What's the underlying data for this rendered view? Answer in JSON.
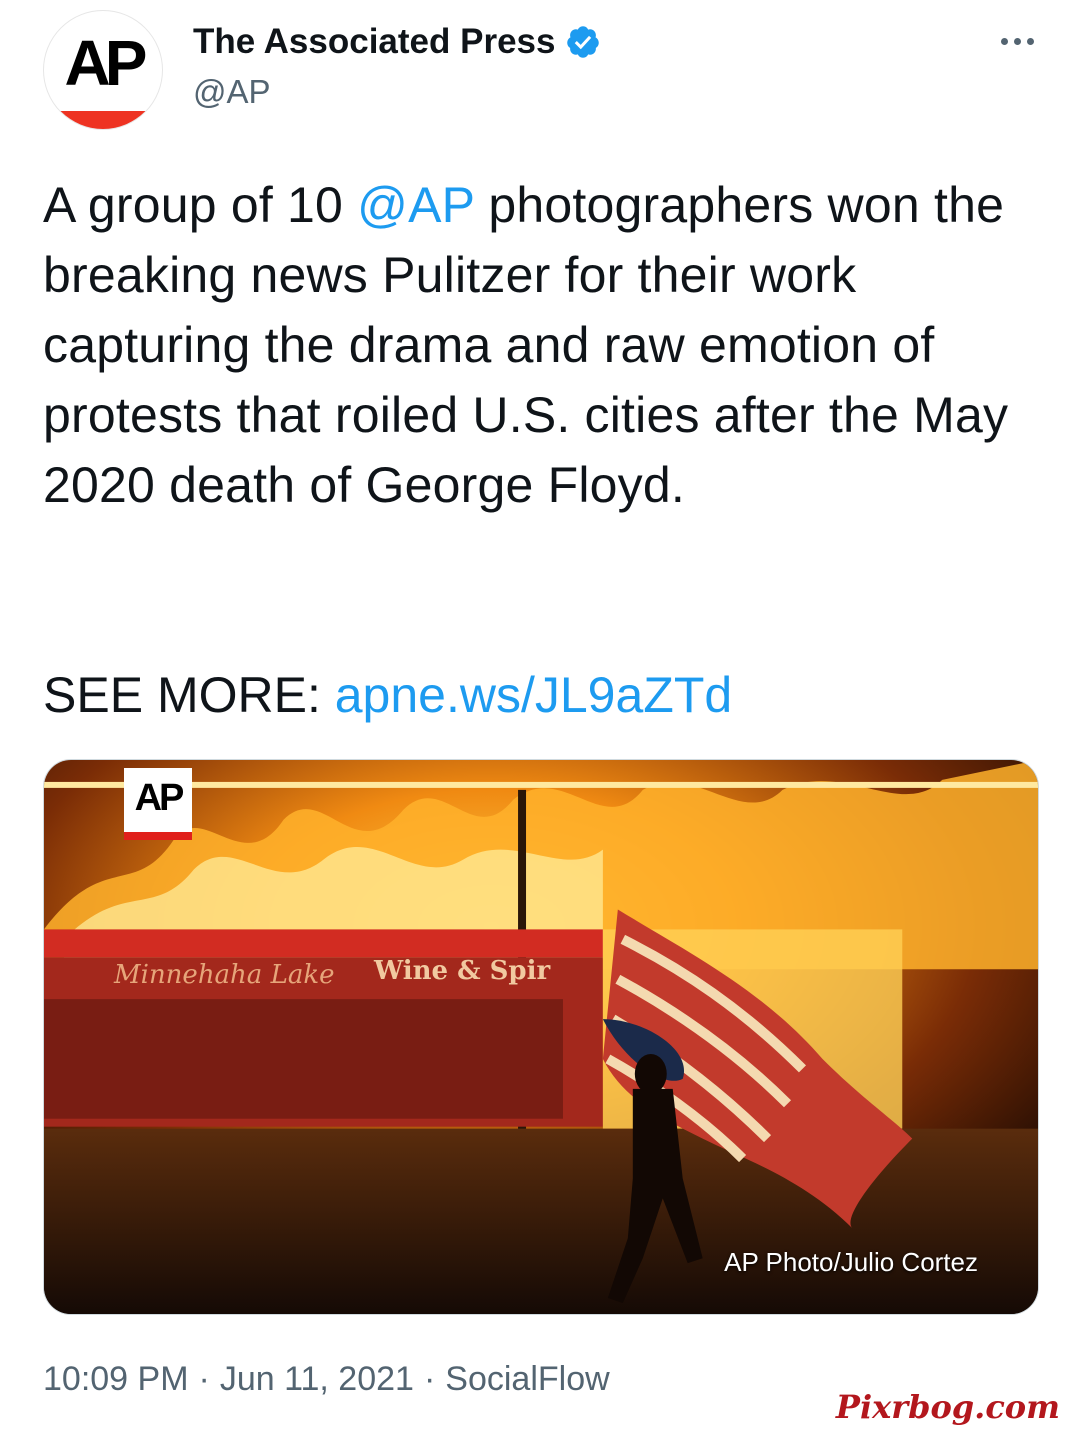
{
  "author": {
    "display_name": "The Associated Press",
    "handle": "@AP",
    "avatar_text": "AP",
    "verified": true
  },
  "tweet": {
    "text_before": "A group of 10 ",
    "mention": "@AP",
    "text_after": " photographers won the breaking news Pulitzer for their work capturing the drama and raw emotion of protests that roiled U.S. cities after the May 2020 death of George Floyd.",
    "see_more_label": "SEE MORE: ",
    "link": "apne.ws/JL9aZTd"
  },
  "media": {
    "logo_text": "AP",
    "credit": "AP Photo/Julio Cortez",
    "sign_script": "Minnehaha Lake",
    "sign_block": "Wine & Spir"
  },
  "meta": {
    "time": "10:09 PM",
    "date": "Jun 11, 2021",
    "source": "SocialFlow",
    "separator": "·"
  },
  "watermark": "Pixrbog.com",
  "colors": {
    "accent": "#1d9bf0",
    "text": "#0f1419",
    "secondary": "#536471",
    "ap_red": "#ee3322"
  }
}
